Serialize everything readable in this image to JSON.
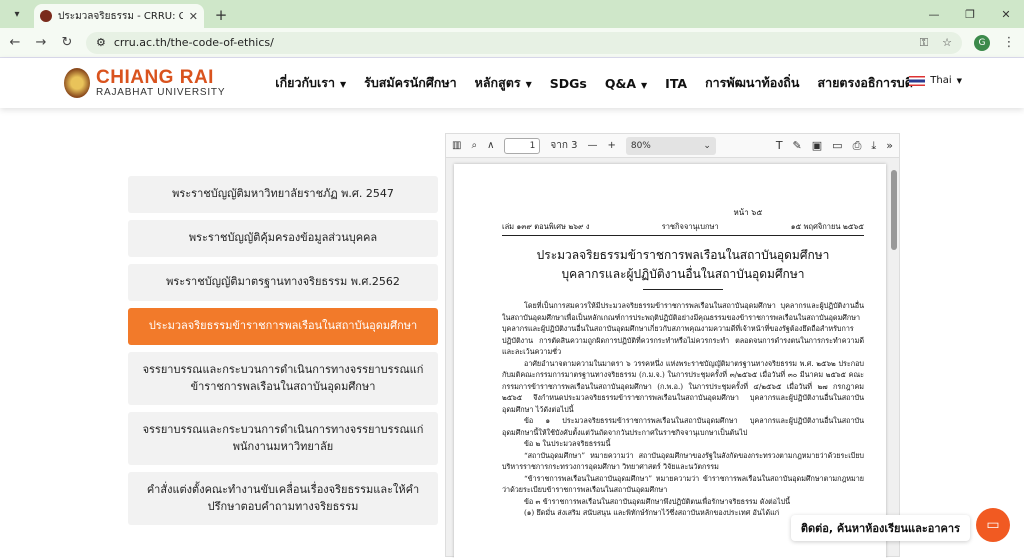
{
  "browser": {
    "tab_title": "ประมวลจริยธรรม - CRRU: Chiang R",
    "url": "crru.ac.th/the-code-of-ethics/",
    "profile_initial": "G"
  },
  "site": {
    "logo_main": "CHIANG RAI",
    "logo_sub": "RAJABHAT UNIVERSITY",
    "nav": [
      {
        "label": "เกี่ยวกับเรา",
        "caret": true
      },
      {
        "label": "รับสมัครนักศึกษา",
        "caret": false
      },
      {
        "label": "หลักสูตร",
        "caret": true
      },
      {
        "label": "SDGs",
        "caret": false
      },
      {
        "label": "Q&A",
        "caret": true
      },
      {
        "label": "ITA",
        "caret": false
      },
      {
        "label": "การพัฒนาท้องถิ่น",
        "caret": false
      },
      {
        "label": "สายตรงอธิการบดี",
        "caret": false
      }
    ],
    "language": "Thai",
    "accent": "#f27a2a"
  },
  "menu": [
    {
      "label": "พระราชบัญญัติมหาวิทยาลัยราชภัฏ พ.ศ. 2547",
      "active": false
    },
    {
      "label": "พระราชบัญญัติคุ้มครองข้อมูลส่วนบุคคล",
      "active": false
    },
    {
      "label": "พระราชบัญญัติมาตรฐานทางจริยธรรม พ.ศ.2562",
      "active": false
    },
    {
      "label": "ประมวลจริยธรรมข้าราชการพลเรือนในสถาบันอุดมศึกษา",
      "active": true
    },
    {
      "label": "จรรยาบรรณและกระบวนการดำเนินการทางจรรยาบรรณแก่ข้าราชการพลเรือนในสถาบันอุดมศึกษา",
      "active": false
    },
    {
      "label": "จรรยาบรรณและกระบวนการดำเนินการทางจรรยาบรรณแก่พนักงานมหาวิทยาลัย",
      "active": false
    },
    {
      "label": "คำสั่งแต่งตั้งคณะทำงานขับเคลื่อนเรื่องจริยธรรมและให้คำปรึกษาตอบคำถามทางจริยธรรม",
      "active": false
    }
  ],
  "pdf": {
    "page_current": "1",
    "page_total": "จาก 3",
    "zoom": "80%",
    "doc_pageno": "หน้า ๖๕",
    "doc_header_left": "เล่ม ๑๓๙ ตอนพิเศษ ๒๖๙ ง",
    "doc_header_mid": "ราชกิจจานุเบกษา",
    "doc_header_right": "๑๕ พฤศจิกายน ๒๕๖๕",
    "doc_title_1": "ประมวลจริยธรรมข้าราชการพลเรือนในสถาบันอุดมศึกษา",
    "doc_title_2": "บุคลากรและผู้ปฏิบัติงานอื่นในสถาบันอุดมศึกษา",
    "paragraphs": [
      "โดยที่เป็นการสมควรให้มีประมวลจริยธรรมข้าราชการพลเรือนในสถาบันอุดมศึกษา บุคลากรและผู้ปฏิบัติงานอื่นในสถาบันอุดมศึกษาเพื่อเป็นหลักเกณฑ์การประพฤติปฏิบัติอย่างมีคุณธรรมของข้าราชการพลเรือนในสถาบันอุดมศึกษา บุคลากรและผู้ปฏิบัติงานอื่นในสถาบันอุดมศึกษาเกี่ยวกับสภาพคุณงามความดีที่เจ้าหน้าที่ของรัฐต้องยึดถือสำหรับการปฏิบัติงาน การตัดสินความถูกผิดการปฏิบัติที่ควรกระทำหรือไม่ควรกระทำ ตลอดจนการดำรงตนในการกระทำความดีและละเว้นความชั่ว",
      "อาศัยอำนาจตามความในมาตรา ๖ วรรคหนึ่ง แห่งพระราชบัญญัติมาตรฐานทางจริยธรรม พ.ศ. ๒๕๖๒ ประกอบกับมติคณะกรรมการมาตรฐานทางจริยธรรม (ก.ม.จ.) ในการประชุมครั้งที่ ๓/๒๕๖๕ เมื่อวันที่ ๓๐ มีนาคม ๒๕๖๕ คณะกรรมการข้าราชการพลเรือนในสถาบันอุดมศึกษา (ก.พ.อ.) ในการประชุมครั้งที่ ๔/๒๕๖๕ เมื่อวันที่ ๒๗ กรกฎาคม ๒๕๖๕ จึงกำหนดประมวลจริยธรรมข้าราชการพลเรือนในสถาบันอุดมศึกษา บุคลากรและผู้ปฏิบัติงานอื่นในสถาบันอุดมศึกษา ไว้ดังต่อไปนี้",
      "ข้อ ๑ ประมวลจริยธรรมข้าราชการพลเรือนในสถาบันอุดมศึกษา บุคลากรและผู้ปฏิบัติงานอื่นในสถาบันอุดมศึกษานี้ให้ใช้บังคับตั้งแต่วันถัดจากวันประกาศในราชกิจจานุเบกษาเป็นต้นไป",
      "ข้อ ๒ ในประมวลจริยธรรมนี้",
      "“สถาบันอุดมศึกษา” หมายความว่า สถาบันอุดมศึกษาของรัฐในสังกัดของกระทรวงตามกฎหมายว่าด้วยระเบียบบริหารราชการกระทรวงการอุดมศึกษา วิทยาศาสตร์ วิจัยและนวัตกรรม",
      "“ข้าราชการพลเรือนในสถาบันอุดมศึกษา” หมายความว่า ข้าราชการพลเรือนในสถาบันอุดมศึกษาตามกฎหมายว่าด้วยระเบียบข้าราชการพลเรือนในสถาบันอุดมศึกษา",
      "ข้อ ๓ ข้าราชการพลเรือนในสถาบันอุดมศึกษาพึงปฏิบัติตนเพื่อรักษาจริยธรรม ดังต่อไปนี้",
      "(๑) ยึดมั่น ส่งเสริม สนับสนุน และพิทักษ์รักษาไว้ซึ่งสถาบันหลักของประเทศ อันได้แก่"
    ]
  },
  "chat": {
    "label": "ติดต่อ, ค้นหาห้องเรียนและอาคาร"
  }
}
